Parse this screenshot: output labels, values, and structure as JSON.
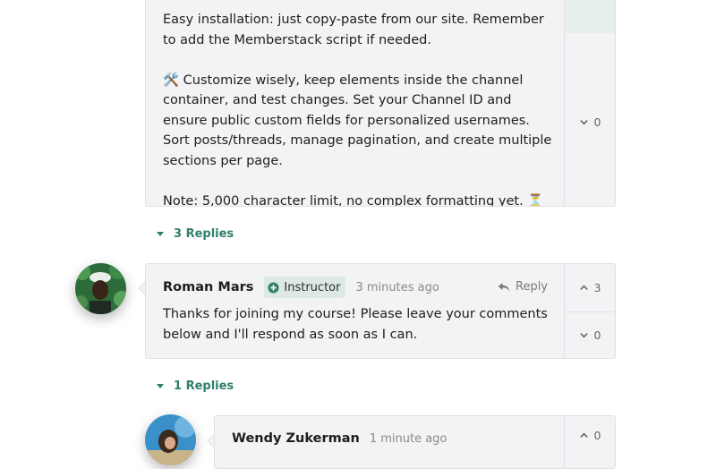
{
  "comments": {
    "top": {
      "paragraphs": [
        "Easy installation: just copy-paste from our site. Remember to add the Memberstack script if needed.",
        "🛠️ Customize wisely, keep elements inside the channel container, and test changes. Set your Channel ID and ensure public custom fields for personalized usernames. Sort posts/threads, manage pagination, and create multiple sections per page.",
        "Note: 5,000 character limit, no complex formatting yet. ⏳"
      ],
      "downvotes": "0",
      "replies_label": "3 Replies"
    },
    "roman": {
      "author": "Roman Mars",
      "badge": "Instructor",
      "time": "3 minutes ago",
      "reply_label": "Reply",
      "text": "Thanks for joining my course! Please leave your comments below and I'll respond as soon as I can.",
      "upvotes": "3",
      "downvotes": "0",
      "replies_label": "1 Replies"
    },
    "wendy": {
      "author": "Wendy Zukerman",
      "time": "1 minute ago",
      "upvotes": "0"
    }
  },
  "colors": {
    "accent": "#2f7f6c",
    "card_bg": "#f3f3f5",
    "badge_bg": "#dde9e5"
  },
  "icons": [
    "chevron-up-icon",
    "chevron-down-icon",
    "reply-arrow-icon",
    "instructor-plus-icon",
    "caret-down-icon"
  ]
}
